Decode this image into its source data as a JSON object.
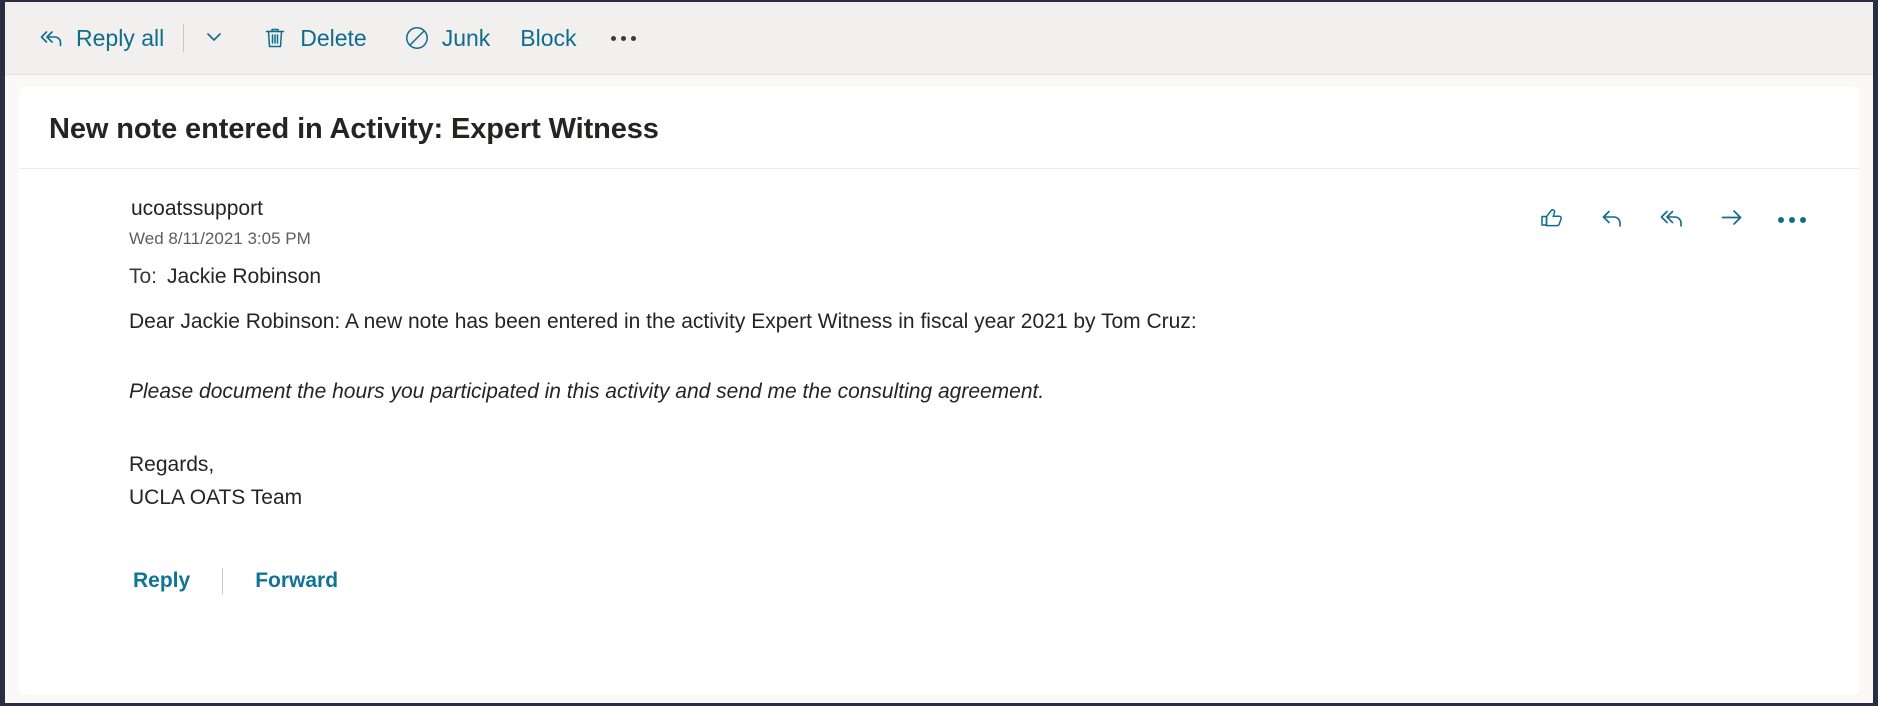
{
  "toolbar": {
    "reply_all_label": "Reply all",
    "reply_all_icon": "reply-all-icon",
    "chevron_icon": "chevron-down-icon",
    "delete_label": "Delete",
    "delete_icon": "trash-icon",
    "junk_label": "Junk",
    "junk_icon": "block-circle-slash-icon",
    "block_label": "Block",
    "more_icon": "more-ellipsis-icon",
    "accent_color": "#0f6c8c",
    "background_color": "#f1f0ef"
  },
  "message": {
    "subject": "New note entered in Activity: Expert Witness",
    "sender": "ucoatssupport",
    "sent_date": "Wed 8/11/2021 3:05 PM",
    "to_label": "To:",
    "to_recipients": "Jackie Robinson",
    "actions": [
      {
        "name": "like-thumbs-up-icon"
      },
      {
        "name": "reply-icon"
      },
      {
        "name": "reply-all-icon"
      },
      {
        "name": "forward-arrow-icon"
      },
      {
        "name": "more-ellipsis-icon"
      }
    ],
    "body": {
      "greeting_paragraph": "Dear Jackie Robinson: A new note has been entered in the activity Expert Witness in fiscal year 2021 by Tom Cruz:",
      "note_paragraph": "Please document the hours you participated in this activity and send me the consulting agreement.",
      "signoff": "Regards,",
      "signature": "UCLA OATS Team"
    },
    "footer": {
      "reply_label": "Reply",
      "forward_label": "Forward",
      "link_color": "#0f7496"
    }
  }
}
